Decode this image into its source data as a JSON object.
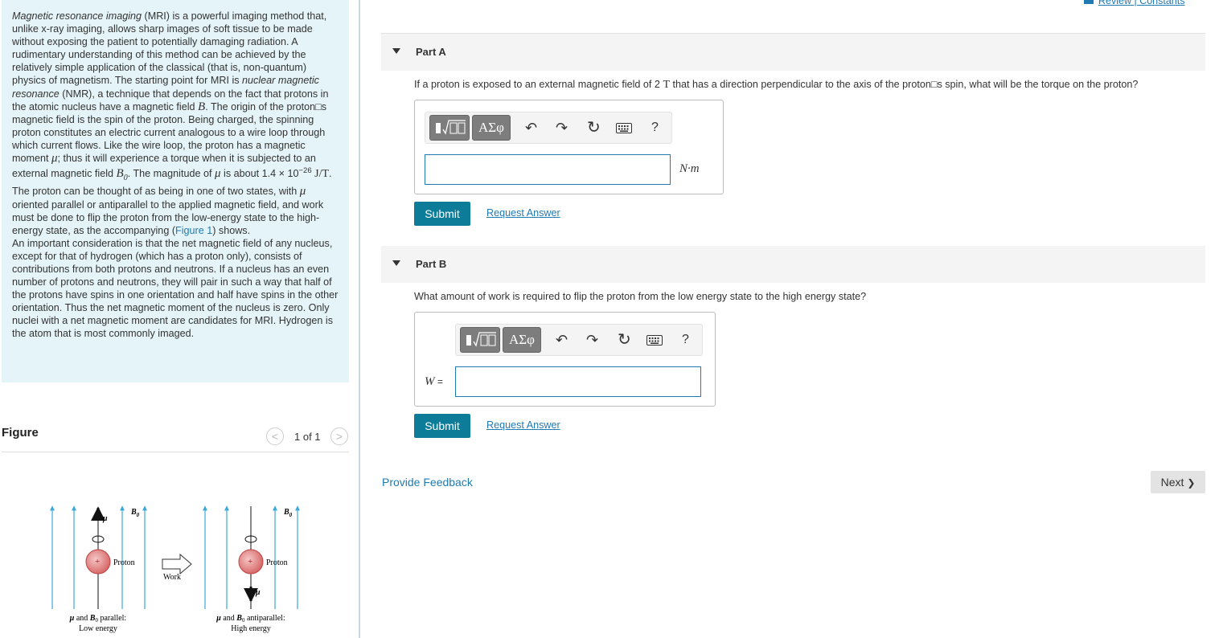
{
  "intro": {
    "s1_italic": "Magnetic resonance imaging",
    "s1": " (MRI) is a powerful imaging method that, unlike x-ray imaging, allows sharp images of soft tissue to be made without exposing the patient to potentially damaging radiation. A rudimentary understanding of this method can be achieved by the relatively simple application of the classical (that is, non-quantum) physics of magnetism. The starting point for MRI is ",
    "s2_italic": "nuclear magnetic resonance",
    "s2": " (NMR), a technique that depends on the fact that protons in the atomic nucleus have a magnetic field ",
    "s3": ". The origin of the proton□s magnetic field is the spin of the proton. Being charged, the spinning proton constitutes an electric current analogous to a wire loop through which current flows. Like the wire loop, the proton has a magnetic moment ",
    "s4": "; thus it will experience a torque when it is subjected to an external magnetic field ",
    "s5": ". The magnitude of ",
    "s6": " is about 1.4 × 10",
    "exp": "−26",
    "unit_jt": " J/T",
    "s7": ". The proton can be thought of as being in one of two states, with ",
    "s8": " oriented parallel or antiparallel to the applied magnetic field, and work must be done to flip the proton from the low-energy state to the high-energy state, as the accompanying (",
    "figure_link": "Figure 1",
    "s9": ") shows.",
    "p2": "An important consideration is that the net magnetic field of any nucleus, except for that of hydrogen (which has a proton only), consists of contributions from both protons and neutrons. If a nucleus has an even number of protons and neutrons, they will pair in such a way that half of the protons have spins in one orientation and half have spins in the other orientation. Thus the net magnetic moment of the nucleus is zero. Only nuclei with a net magnetic moment are candidates for MRI. Hydrogen is the atom that is most commonly imaged.",
    "sym_B": "B",
    "sym_mu": "μ",
    "sym_B0": "B",
    "sym_B0_sub": "0"
  },
  "figure": {
    "title": "Figure",
    "count": "1 of 1",
    "prev": "<",
    "next": ">",
    "proton_label": "Proton",
    "work_label": "Work",
    "b0_label": "B",
    "b0_sub": "0",
    "mu_label": "μ",
    "plus": "+",
    "left_caption_1a": "μ",
    "left_caption_1b": " and ",
    "left_caption_1c": "B",
    "left_caption_1d": "0",
    "left_caption_1e": " parallel:",
    "left_caption_2": "Low energy",
    "right_caption_1a": "μ",
    "right_caption_1b": " and ",
    "right_caption_1c": "B",
    "right_caption_1d": "0",
    "right_caption_1e": " antiparallel:",
    "right_caption_2": "High energy"
  },
  "header": {
    "review_link": "Review | Constants"
  },
  "partA": {
    "label": "Part A",
    "question_a": "If a proton is exposed to an external magnetic field of 2 ",
    "question_T": "T",
    "question_b": " that has a direction perpendicular to the axis of the proton□s spin, what will be the torque on the proton?",
    "unit": "N·m",
    "submit": "Submit",
    "request": "Request Answer",
    "input_value": ""
  },
  "partB": {
    "label": "Part B",
    "question": "What amount of work is required to flip the proton from the low energy state to the high energy state?",
    "var_label": "W",
    "eq": " =",
    "submit": "Submit",
    "request": "Request Answer",
    "input_value": ""
  },
  "toolbar": {
    "greek": "ΑΣφ",
    "undo": "↶",
    "redo": "↷",
    "reset": "↻",
    "help": "?"
  },
  "footer": {
    "feedback": "Provide Feedback",
    "next": "Next",
    "next_chevron": "❯"
  }
}
